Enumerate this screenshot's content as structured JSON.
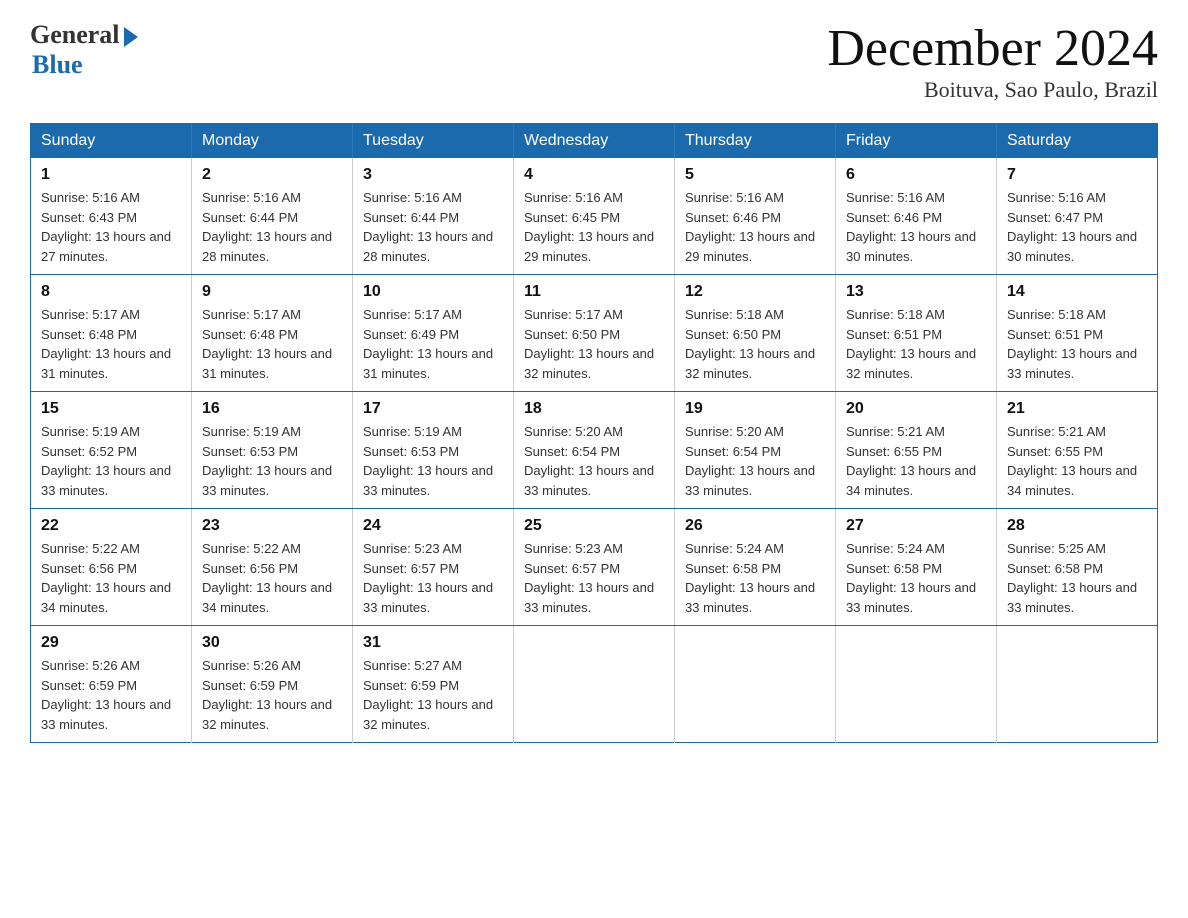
{
  "header": {
    "logo_general": "General",
    "logo_blue": "Blue",
    "month_title": "December 2024",
    "location": "Boituva, Sao Paulo, Brazil"
  },
  "weekdays": [
    "Sunday",
    "Monday",
    "Tuesday",
    "Wednesday",
    "Thursday",
    "Friday",
    "Saturday"
  ],
  "weeks": [
    [
      {
        "day": "1",
        "sunrise": "5:16 AM",
        "sunset": "6:43 PM",
        "daylight": "13 hours and 27 minutes."
      },
      {
        "day": "2",
        "sunrise": "5:16 AM",
        "sunset": "6:44 PM",
        "daylight": "13 hours and 28 minutes."
      },
      {
        "day": "3",
        "sunrise": "5:16 AM",
        "sunset": "6:44 PM",
        "daylight": "13 hours and 28 minutes."
      },
      {
        "day": "4",
        "sunrise": "5:16 AM",
        "sunset": "6:45 PM",
        "daylight": "13 hours and 29 minutes."
      },
      {
        "day": "5",
        "sunrise": "5:16 AM",
        "sunset": "6:46 PM",
        "daylight": "13 hours and 29 minutes."
      },
      {
        "day": "6",
        "sunrise": "5:16 AM",
        "sunset": "6:46 PM",
        "daylight": "13 hours and 30 minutes."
      },
      {
        "day": "7",
        "sunrise": "5:16 AM",
        "sunset": "6:47 PM",
        "daylight": "13 hours and 30 minutes."
      }
    ],
    [
      {
        "day": "8",
        "sunrise": "5:17 AM",
        "sunset": "6:48 PM",
        "daylight": "13 hours and 31 minutes."
      },
      {
        "day": "9",
        "sunrise": "5:17 AM",
        "sunset": "6:48 PM",
        "daylight": "13 hours and 31 minutes."
      },
      {
        "day": "10",
        "sunrise": "5:17 AM",
        "sunset": "6:49 PM",
        "daylight": "13 hours and 31 minutes."
      },
      {
        "day": "11",
        "sunrise": "5:17 AM",
        "sunset": "6:50 PM",
        "daylight": "13 hours and 32 minutes."
      },
      {
        "day": "12",
        "sunrise": "5:18 AM",
        "sunset": "6:50 PM",
        "daylight": "13 hours and 32 minutes."
      },
      {
        "day": "13",
        "sunrise": "5:18 AM",
        "sunset": "6:51 PM",
        "daylight": "13 hours and 32 minutes."
      },
      {
        "day": "14",
        "sunrise": "5:18 AM",
        "sunset": "6:51 PM",
        "daylight": "13 hours and 33 minutes."
      }
    ],
    [
      {
        "day": "15",
        "sunrise": "5:19 AM",
        "sunset": "6:52 PM",
        "daylight": "13 hours and 33 minutes."
      },
      {
        "day": "16",
        "sunrise": "5:19 AM",
        "sunset": "6:53 PM",
        "daylight": "13 hours and 33 minutes."
      },
      {
        "day": "17",
        "sunrise": "5:19 AM",
        "sunset": "6:53 PM",
        "daylight": "13 hours and 33 minutes."
      },
      {
        "day": "18",
        "sunrise": "5:20 AM",
        "sunset": "6:54 PM",
        "daylight": "13 hours and 33 minutes."
      },
      {
        "day": "19",
        "sunrise": "5:20 AM",
        "sunset": "6:54 PM",
        "daylight": "13 hours and 33 minutes."
      },
      {
        "day": "20",
        "sunrise": "5:21 AM",
        "sunset": "6:55 PM",
        "daylight": "13 hours and 34 minutes."
      },
      {
        "day": "21",
        "sunrise": "5:21 AM",
        "sunset": "6:55 PM",
        "daylight": "13 hours and 34 minutes."
      }
    ],
    [
      {
        "day": "22",
        "sunrise": "5:22 AM",
        "sunset": "6:56 PM",
        "daylight": "13 hours and 34 minutes."
      },
      {
        "day": "23",
        "sunrise": "5:22 AM",
        "sunset": "6:56 PM",
        "daylight": "13 hours and 34 minutes."
      },
      {
        "day": "24",
        "sunrise": "5:23 AM",
        "sunset": "6:57 PM",
        "daylight": "13 hours and 33 minutes."
      },
      {
        "day": "25",
        "sunrise": "5:23 AM",
        "sunset": "6:57 PM",
        "daylight": "13 hours and 33 minutes."
      },
      {
        "day": "26",
        "sunrise": "5:24 AM",
        "sunset": "6:58 PM",
        "daylight": "13 hours and 33 minutes."
      },
      {
        "day": "27",
        "sunrise": "5:24 AM",
        "sunset": "6:58 PM",
        "daylight": "13 hours and 33 minutes."
      },
      {
        "day": "28",
        "sunrise": "5:25 AM",
        "sunset": "6:58 PM",
        "daylight": "13 hours and 33 minutes."
      }
    ],
    [
      {
        "day": "29",
        "sunrise": "5:26 AM",
        "sunset": "6:59 PM",
        "daylight": "13 hours and 33 minutes."
      },
      {
        "day": "30",
        "sunrise": "5:26 AM",
        "sunset": "6:59 PM",
        "daylight": "13 hours and 32 minutes."
      },
      {
        "day": "31",
        "sunrise": "5:27 AM",
        "sunset": "6:59 PM",
        "daylight": "13 hours and 32 minutes."
      },
      null,
      null,
      null,
      null
    ]
  ]
}
